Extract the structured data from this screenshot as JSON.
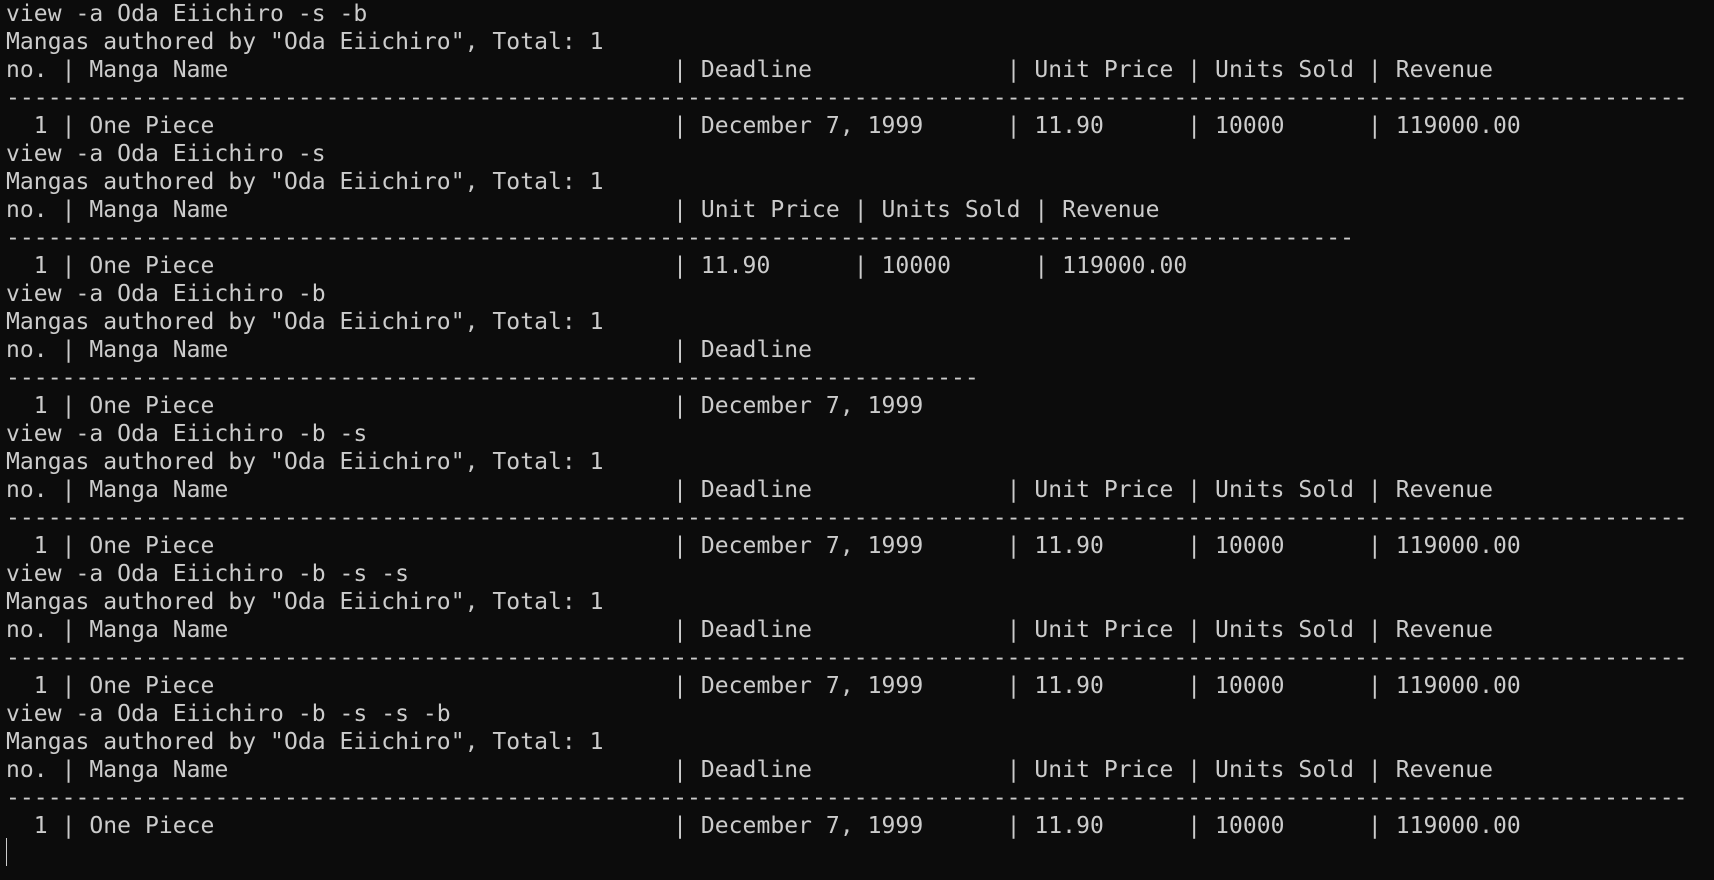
{
  "terminal": {
    "lines": [
      "view -a Oda Eiichiro -s -b",
      "Mangas authored by \"Oda Eiichiro\", Total: 1",
      "no. | Manga Name                                | Deadline              | Unit Price | Units Sold | Revenue",
      "-------------------------------------------------------------------------------------------------------------------------",
      "  1 | One Piece                                 | December 7, 1999      | 11.90      | 10000      | 119000.00",
      "view -a Oda Eiichiro -s",
      "Mangas authored by \"Oda Eiichiro\", Total: 1",
      "no. | Manga Name                                | Unit Price | Units Sold | Revenue",
      "-------------------------------------------------------------------------------------------------",
      "  1 | One Piece                                 | 11.90      | 10000      | 119000.00",
      "view -a Oda Eiichiro -b",
      "Mangas authored by \"Oda Eiichiro\", Total: 1",
      "no. | Manga Name                                | Deadline",
      "----------------------------------------------------------------------",
      "  1 | One Piece                                 | December 7, 1999",
      "view -a Oda Eiichiro -b -s",
      "Mangas authored by \"Oda Eiichiro\", Total: 1",
      "no. | Manga Name                                | Deadline              | Unit Price | Units Sold | Revenue",
      "-------------------------------------------------------------------------------------------------------------------------",
      "  1 | One Piece                                 | December 7, 1999      | 11.90      | 10000      | 119000.00",
      "view -a Oda Eiichiro -b -s -s",
      "Mangas authored by \"Oda Eiichiro\", Total: 1",
      "no. | Manga Name                                | Deadline              | Unit Price | Units Sold | Revenue",
      "-------------------------------------------------------------------------------------------------------------------------",
      "  1 | One Piece                                 | December 7, 1999      | 11.90      | 10000      | 119000.00",
      "view -a Oda Eiichiro -b -s -s -b",
      "Mangas authored by \"Oda Eiichiro\", Total: 1",
      "no. | Manga Name                                | Deadline              | Unit Price | Units Sold | Revenue",
      "-------------------------------------------------------------------------------------------------------------------------",
      "  1 | One Piece                                 | December 7, 1999      | 11.90      | 10000      | 119000.00"
    ]
  },
  "colors": {
    "background": "#0c0c0c",
    "foreground": "#cccccc"
  }
}
